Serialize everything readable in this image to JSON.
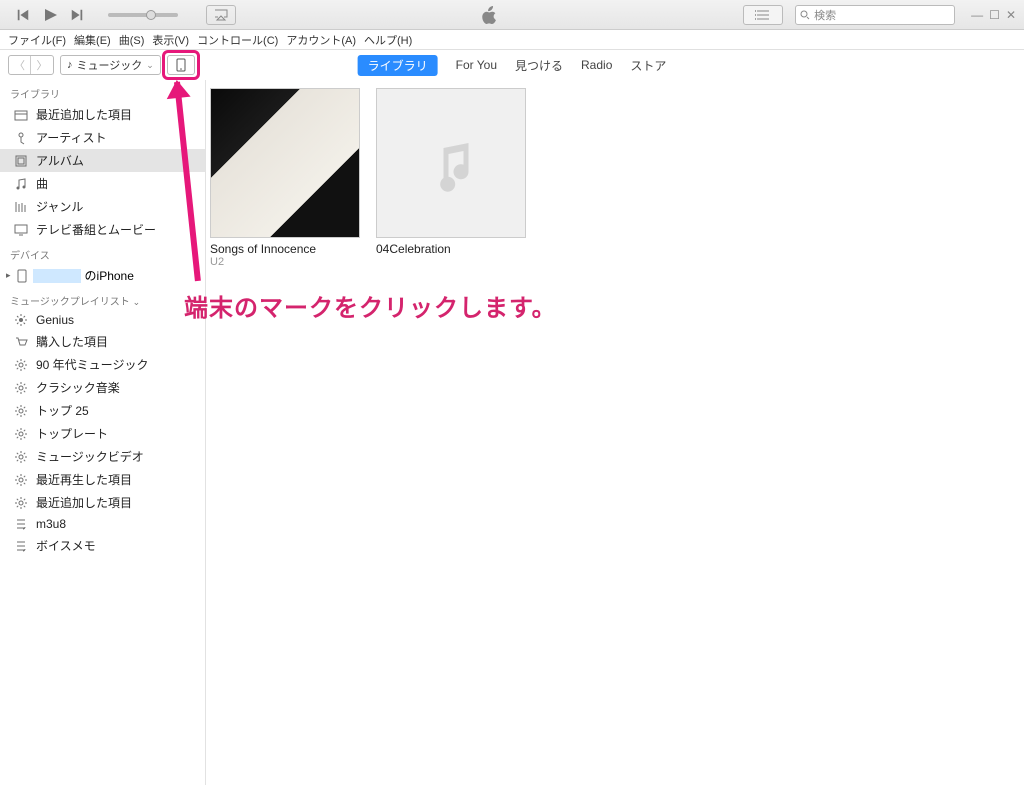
{
  "player": {
    "search_placeholder": "検索"
  },
  "menu": {
    "file": "ファイル(F)",
    "edit": "編集(E)",
    "song": "曲(S)",
    "view": "表示(V)",
    "controls": "コントロール(C)",
    "account": "アカウント(A)",
    "help": "ヘルプ(H)"
  },
  "toolbar": {
    "picker_label": "ミュージック",
    "tabs": {
      "library": "ライブラリ",
      "for_you": "For You",
      "browse": "見つける",
      "radio": "Radio",
      "store": "ストア"
    }
  },
  "sidebar": {
    "library_header": "ライブラリ",
    "library": [
      {
        "icon": "recent",
        "label": "最近追加した項目"
      },
      {
        "icon": "artist",
        "label": "アーティスト"
      },
      {
        "icon": "album",
        "label": "アルバム",
        "selected": true
      },
      {
        "icon": "song",
        "label": "曲"
      },
      {
        "icon": "genre",
        "label": "ジャンル"
      },
      {
        "icon": "tv",
        "label": "テレビ番組とムービー"
      }
    ],
    "devices_header": "デバイス",
    "device_suffix": "のiPhone",
    "playlists_header": "ミュージックプレイリスト",
    "playlists": [
      {
        "icon": "genius",
        "label": "Genius"
      },
      {
        "icon": "purchased",
        "label": "購入した項目"
      },
      {
        "icon": "gear",
        "label": "90 年代ミュージック"
      },
      {
        "icon": "gear",
        "label": "クラシック音楽"
      },
      {
        "icon": "gear",
        "label": "トップ 25"
      },
      {
        "icon": "gear",
        "label": "トップレート"
      },
      {
        "icon": "gear",
        "label": "ミュージックビデオ"
      },
      {
        "icon": "gear",
        "label": "最近再生した項目"
      },
      {
        "icon": "gear",
        "label": "最近追加した項目"
      },
      {
        "icon": "list",
        "label": "m3u8"
      },
      {
        "icon": "list",
        "label": "ボイスメモ"
      }
    ]
  },
  "albums": [
    {
      "title": "Songs of Innocence",
      "artist": "U2",
      "art": "photo"
    },
    {
      "title": "04Celebration",
      "artist": "",
      "art": "placeholder"
    }
  ],
  "annotation": "端末のマークをクリックします。"
}
